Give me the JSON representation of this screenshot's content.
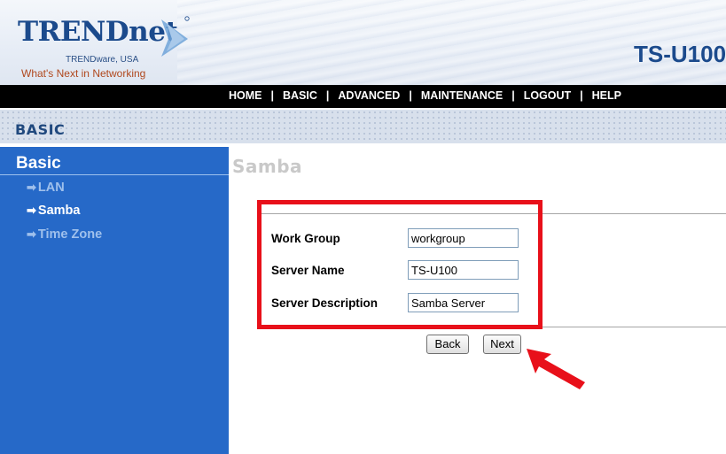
{
  "header": {
    "logo_text": "TRENDnet",
    "logo_subtitle": "TRENDware, USA",
    "logo_tagline": "What's Next in Networking",
    "model": "TS-U100"
  },
  "nav": {
    "items": [
      "HOME",
      "BASIC",
      "ADVANCED",
      "MAINTENANCE",
      "LOGOUT",
      "HELP"
    ]
  },
  "banner": {
    "title": "BASIC"
  },
  "sidebar": {
    "title": "Basic",
    "items": [
      {
        "label": "LAN",
        "state": "normal"
      },
      {
        "label": "Samba",
        "state": "active"
      },
      {
        "label": "Time Zone",
        "state": "normal"
      }
    ]
  },
  "main": {
    "title": "Samba",
    "fields": [
      {
        "label": "Work Group",
        "value": "workgroup"
      },
      {
        "label": "Server Name",
        "value": "TS-U100"
      },
      {
        "label": "Server Description",
        "value": "Samba Server"
      }
    ],
    "buttons": {
      "back": "Back",
      "next": "Next"
    }
  },
  "colors": {
    "sidebar_bg": "#2669c8",
    "nav_bg": "#000000",
    "highlight": "#e8101a",
    "brand_blue": "#1b4a8c"
  }
}
